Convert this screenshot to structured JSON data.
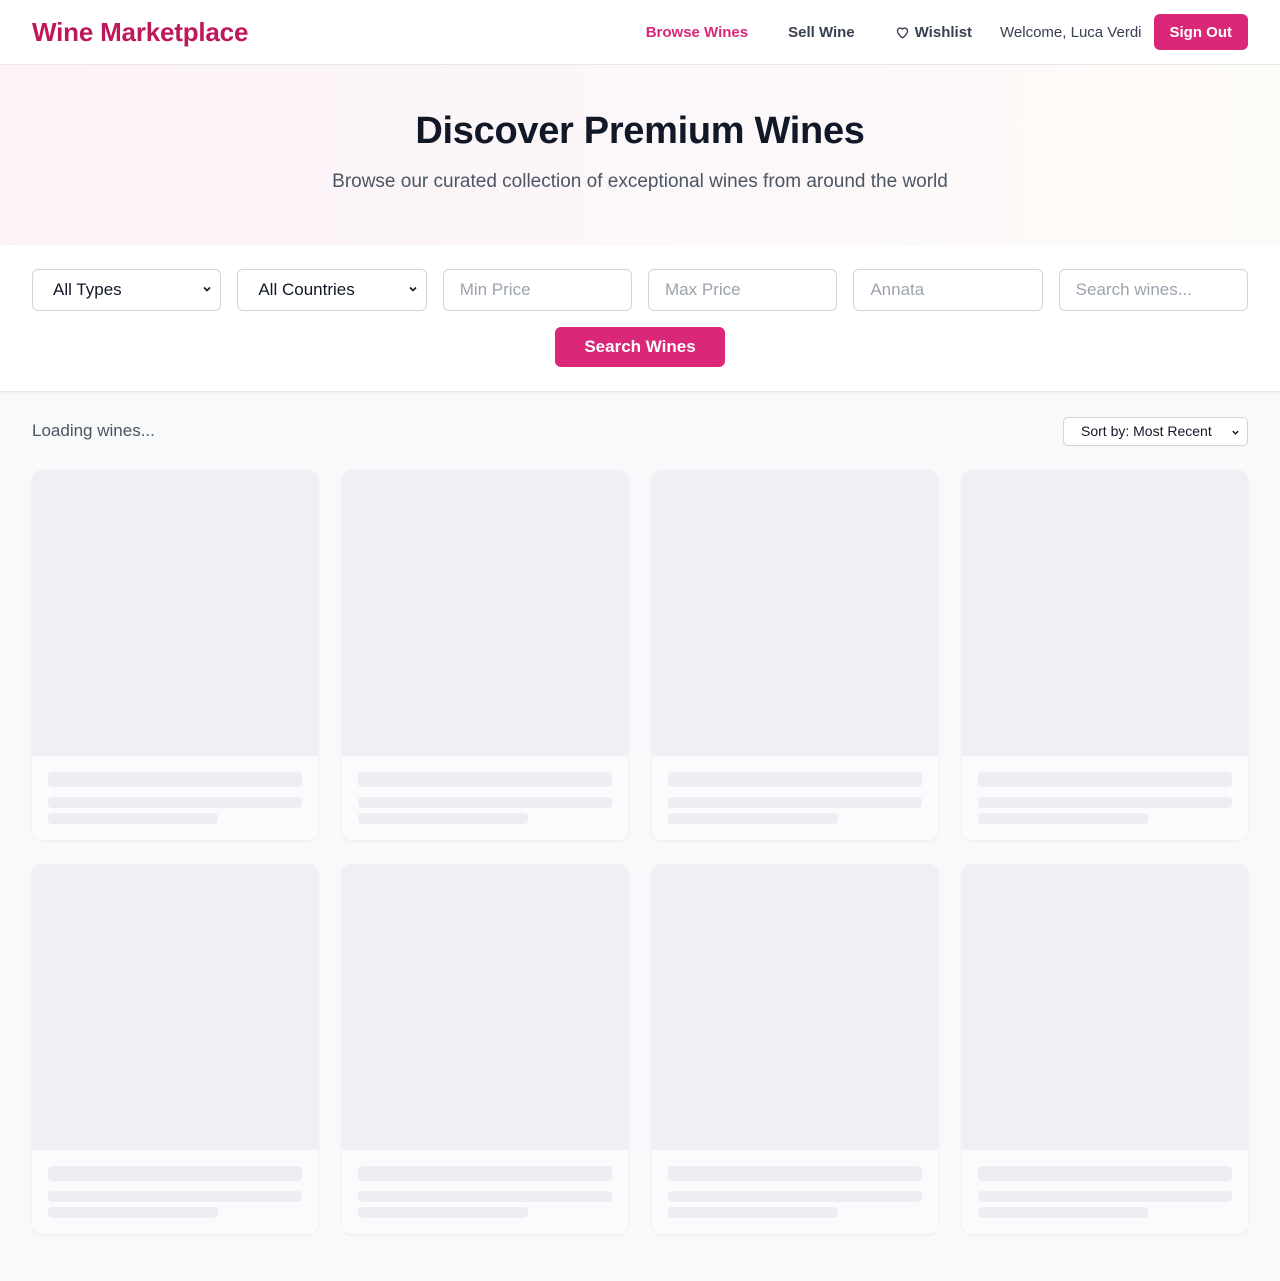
{
  "header": {
    "logo": "Wine Marketplace",
    "nav": {
      "browse": "Browse Wines",
      "sell": "Sell Wine",
      "wishlist": "Wishlist"
    },
    "welcome": "Welcome, Luca Verdi",
    "sign_out": "Sign Out"
  },
  "hero": {
    "title": "Discover Premium Wines",
    "subtitle": "Browse our curated collection of exceptional wines from around the world"
  },
  "filters": {
    "type_selected": "All Types",
    "country_selected": "All Countries",
    "min_price_placeholder": "Min Price",
    "max_price_placeholder": "Max Price",
    "vintage_placeholder": "Annata",
    "search_placeholder": "Search wines...",
    "search_button": "Search Wines"
  },
  "results": {
    "status": "Loading wines...",
    "sort_selected": "Sort by: Most Recent",
    "skeleton_count": 8
  },
  "colors": {
    "brand": "#db2777",
    "brand_dark": "#be185d",
    "skeleton": "#eef0f3"
  },
  "icons": {
    "wishlist": "heart-outline-icon",
    "select": "chevron-down-icon"
  }
}
